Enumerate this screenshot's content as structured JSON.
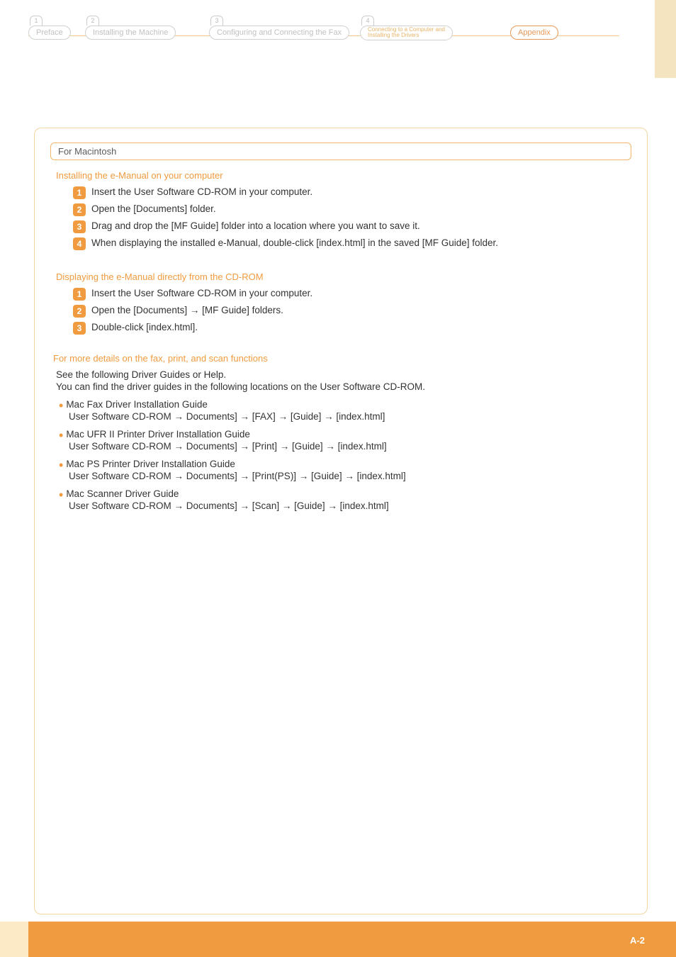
{
  "breadcrumb": {
    "items": [
      {
        "num": "1",
        "label": "Preface"
      },
      {
        "num": "2",
        "label": "Installing the Machine"
      },
      {
        "num": "3",
        "label": "Configuring and Connecting the Fax"
      },
      {
        "num": "4",
        "line1": "Connecting to a Computer and",
        "line2": "Installing the Drivers"
      },
      {
        "label": "Appendix"
      }
    ]
  },
  "pill_header": "For Macintosh",
  "install_section": {
    "title": "Installing the e-Manual on your computer",
    "steps": [
      "Insert the User Software CD-ROM in your computer.",
      "Open the [Documents] folder.",
      "Drag and drop the [MF Guide] folder into a location where you want to save it.",
      "When displaying the installed e-Manual, double-click [index.html] in the saved [MF Guide] folder."
    ]
  },
  "display_section": {
    "title": "Displaying the e-Manual directly from the CD-ROM",
    "steps": [
      "Insert the User Software CD-ROM in your computer.",
      "Open the [Documents] → [MF Guide] folders.",
      "Double-click [index.html]."
    ]
  },
  "details_section": {
    "title": "For more details on the fax, print, and scan functions",
    "intro1": "See the following Driver Guides or Help.",
    "intro2": "You can find the driver guides in the following locations on the User Software CD-ROM.",
    "bullets": [
      {
        "head": "Mac Fax Driver Installation Guide",
        "path": "User Software CD-ROM → Documents] → [FAX] → [Guide] → [index.html]"
      },
      {
        "head": "Mac UFR II Printer Driver Installation Guide",
        "path": "User Software CD-ROM → Documents] → [Print] → [Guide] → [index.html]"
      },
      {
        "head": "Mac PS Printer Driver Installation Guide",
        "path": "User Software CD-ROM → Documents] → [Print(PS)] → [Guide] → [index.html]"
      },
      {
        "head": "Mac Scanner Driver Guide",
        "path": "User Software CD-ROM → Documents] → [Scan] → [Guide] → [index.html]"
      }
    ]
  },
  "page_number": "A-2",
  "nums": {
    "n1": "1",
    "n2": "2",
    "n3": "3",
    "n4": "4"
  }
}
